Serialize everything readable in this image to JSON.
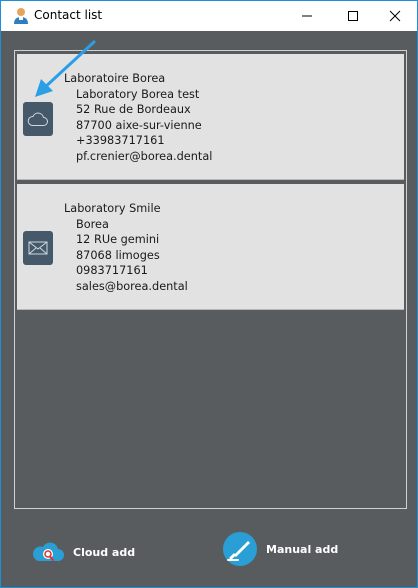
{
  "window": {
    "title": "Contact list",
    "minimize": "minimize",
    "maximize": "maximize",
    "close": "close"
  },
  "contacts": [
    {
      "icon": "cloud-icon",
      "name": "Laboratoire Borea",
      "company": "Laboratory Borea test",
      "street": "52 Rue de Bordeaux",
      "city": "87700 aixe-sur-vienne",
      "phone": "+33983717161",
      "email": "pf.crenier@borea.dental"
    },
    {
      "icon": "envelope-icon",
      "name": "Laboratory Smile",
      "company": "Borea",
      "street": "12 RUe gemini",
      "city": "87068 limoges",
      "phone": "0983717161",
      "email": "sales@borea.dental"
    }
  ],
  "actions": {
    "cloud_add": "Cloud add",
    "manual_add": "Manual add"
  },
  "colors": {
    "accent": "#1b8fd8",
    "background": "#595c5e",
    "card": "#e2e2e2",
    "icon_tile": "#46596a",
    "action_icon": "#2a9fd6",
    "arrow": "#2a9fe6"
  }
}
